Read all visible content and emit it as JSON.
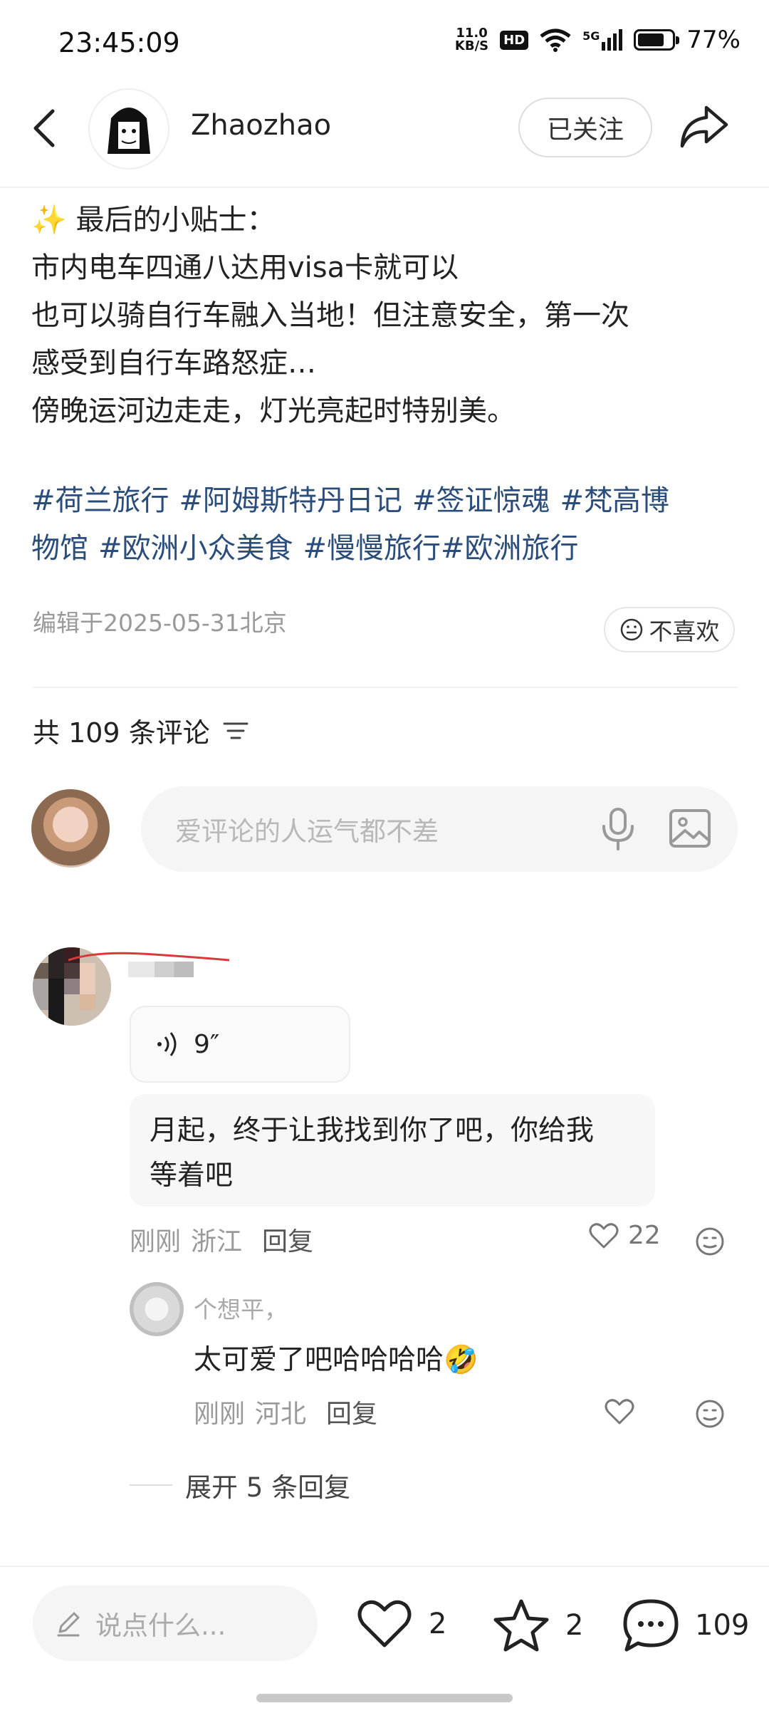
{
  "status_bar": {
    "time": "23:45:09",
    "net_speed_value": "11.0",
    "net_speed_unit": "KB/S",
    "hd": "HD",
    "network": "5G",
    "battery": "77%",
    "battery_level": 0.77
  },
  "header": {
    "author_name": "Zhaozhao",
    "follow_label": "已关注"
  },
  "post": {
    "lines": [
      "✨ 最后的小贴士：",
      "市内电车四通八达用visa卡就可以",
      "也可以骑自行车融入当地！但注意安全，第一次",
      "感受到自行车路怒症…",
      "傍晚运河边走走，灯光亮起时特别美。"
    ],
    "tags": [
      "#荷兰旅行",
      "#阿姆斯特丹日记",
      "#签证惊魂",
      "#梵高博",
      "物馆",
      "#欧洲小众美食",
      "#慢慢旅行#欧洲旅行"
    ],
    "edit_info": "编辑于2025-05-31北京",
    "dislike_label": "不喜欢"
  },
  "comments_section": {
    "count_label": "共 109 条评论",
    "input_placeholder": "爱评论的人运气都不差"
  },
  "comments": [
    {
      "voice_duration": "9″",
      "text_lines": [
        "月起，终于让我找到你了吧，你给我",
        "等着吧"
      ],
      "time": "刚刚",
      "location": "浙江",
      "reply_label": "回复",
      "likes": "22",
      "replies": [
        {
          "name": "个想平，",
          "text": "太可爱了吧哈哈哈哈🤣",
          "time": "刚刚",
          "location": "河北",
          "reply_label": "回复"
        }
      ],
      "expand_label": "展开 5 条回复"
    }
  ],
  "bottom_bar": {
    "input_placeholder": "说点什么...",
    "likes": "2",
    "stars": "2",
    "comments": "109"
  }
}
